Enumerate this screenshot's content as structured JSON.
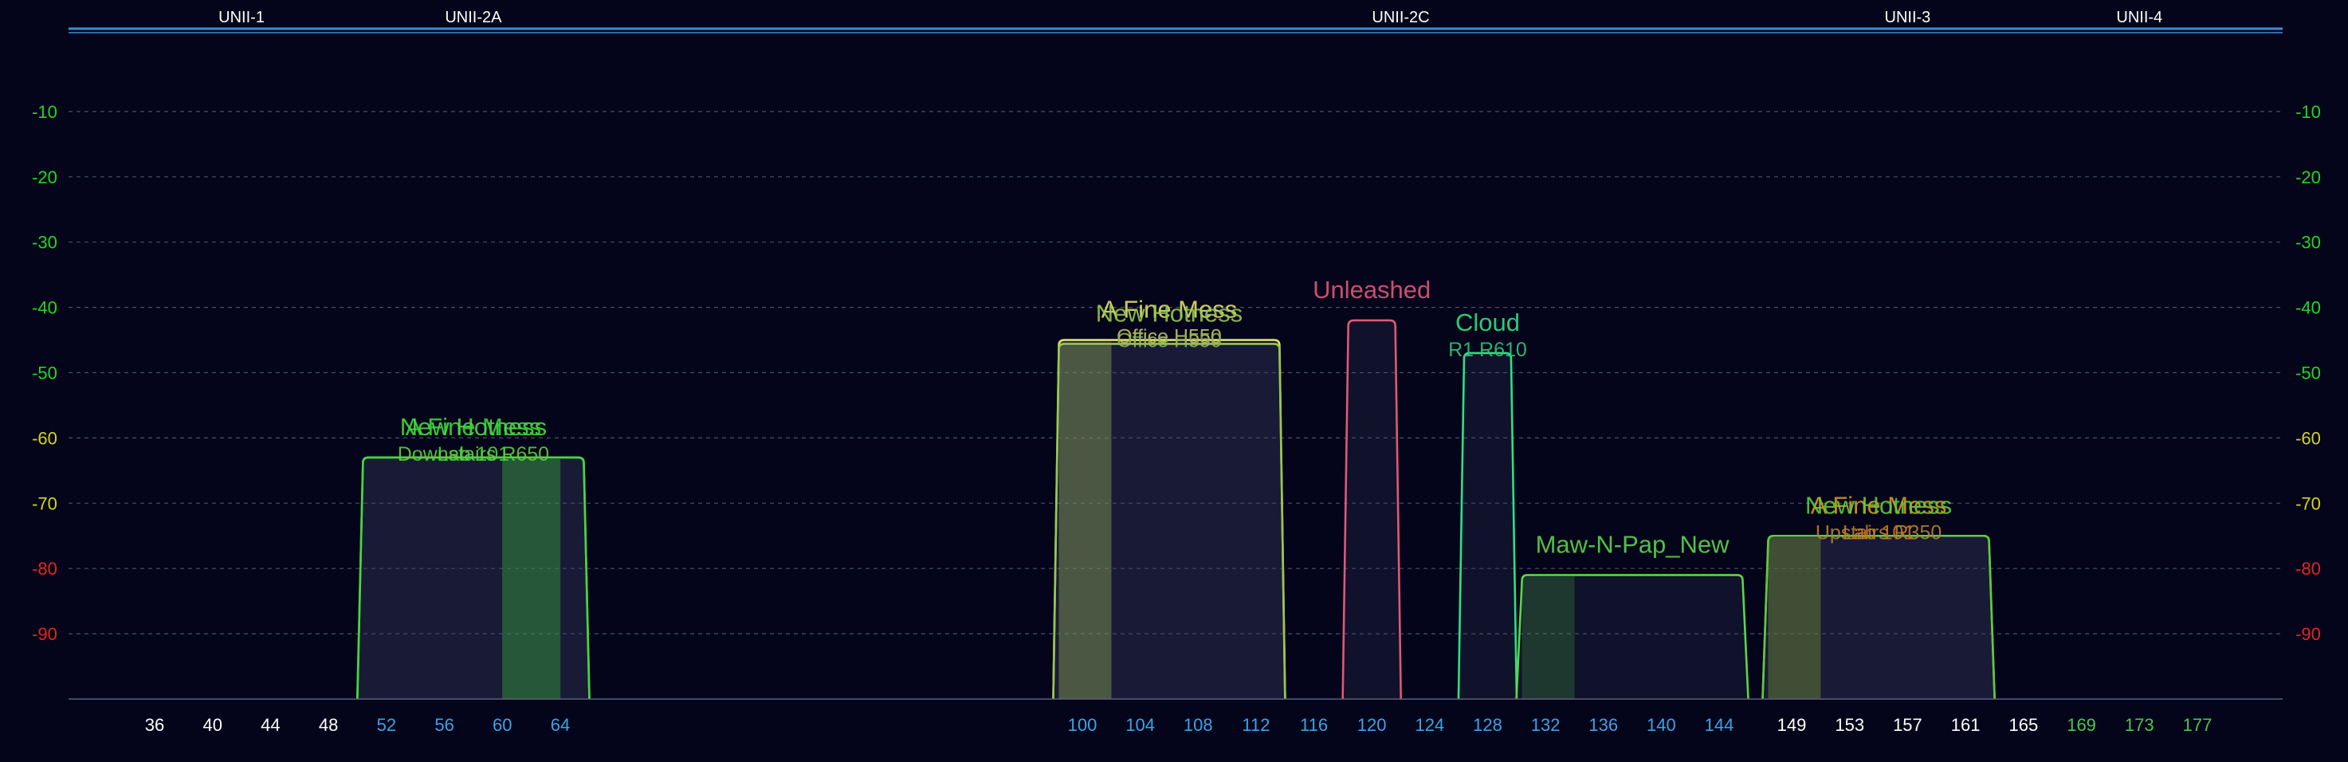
{
  "chart_data": {
    "type": "area",
    "title": "",
    "xlabel": "",
    "ylabel": "",
    "ylim": [
      -100,
      0
    ],
    "grid": true,
    "y_ticks": [
      {
        "value": -10,
        "color": "#22d722"
      },
      {
        "value": -20,
        "color": "#22d722"
      },
      {
        "value": -30,
        "color": "#22d722"
      },
      {
        "value": -40,
        "color": "#22d722"
      },
      {
        "value": -50,
        "color": "#22d722"
      },
      {
        "value": -60,
        "color": "#d4d41e"
      },
      {
        "value": -70,
        "color": "#d4d41e"
      },
      {
        "value": -80,
        "color": "#e0281e"
      },
      {
        "value": -90,
        "color": "#e0281e"
      }
    ],
    "x_ticks": [
      {
        "label": "36",
        "channel": 36,
        "color": "#ffffff"
      },
      {
        "label": "40",
        "channel": 40,
        "color": "#ffffff"
      },
      {
        "label": "44",
        "channel": 44,
        "color": "#ffffff"
      },
      {
        "label": "48",
        "channel": 48,
        "color": "#ffffff"
      },
      {
        "label": "52",
        "channel": 52,
        "color": "#3ba3e8"
      },
      {
        "label": "56",
        "channel": 56,
        "color": "#3ba3e8"
      },
      {
        "label": "60",
        "channel": 60,
        "color": "#3ba3e8"
      },
      {
        "label": "64",
        "channel": 64,
        "color": "#3ba3e8"
      },
      {
        "label": "100",
        "channel": 100,
        "color": "#3ba3e8"
      },
      {
        "label": "104",
        "channel": 104,
        "color": "#3ba3e8"
      },
      {
        "label": "108",
        "channel": 108,
        "color": "#3ba3e8"
      },
      {
        "label": "112",
        "channel": 112,
        "color": "#3ba3e8"
      },
      {
        "label": "116",
        "channel": 116,
        "color": "#3ba3e8"
      },
      {
        "label": "120",
        "channel": 120,
        "color": "#3ba3e8"
      },
      {
        "label": "124",
        "channel": 124,
        "color": "#3ba3e8"
      },
      {
        "label": "128",
        "channel": 128,
        "color": "#3ba3e8"
      },
      {
        "label": "132",
        "channel": 132,
        "color": "#3ba3e8"
      },
      {
        "label": "136",
        "channel": 136,
        "color": "#3ba3e8"
      },
      {
        "label": "140",
        "channel": 140,
        "color": "#3ba3e8"
      },
      {
        "label": "144",
        "channel": 144,
        "color": "#3ba3e8"
      },
      {
        "label": "149",
        "channel": 149,
        "color": "#ffffff"
      },
      {
        "label": "153",
        "channel": 153,
        "color": "#ffffff"
      },
      {
        "label": "157",
        "channel": 157,
        "color": "#ffffff"
      },
      {
        "label": "161",
        "channel": 161,
        "color": "#ffffff"
      },
      {
        "label": "165",
        "channel": 165,
        "color": "#ffffff"
      },
      {
        "label": "169",
        "channel": 169,
        "color": "#4cc64c"
      },
      {
        "label": "173",
        "channel": 173,
        "color": "#4cc64c"
      },
      {
        "label": "177",
        "channel": 177,
        "color": "#4cc64c"
      }
    ],
    "bands": [
      {
        "label": "UNII-1",
        "channel": 42
      },
      {
        "label": "UNII-2A",
        "channel": 58
      },
      {
        "label": "UNII-2C",
        "channel": 122
      },
      {
        "label": "UNII-3",
        "channel": 157
      },
      {
        "label": "UNII-4",
        "channel": 173
      }
    ],
    "series": [
      {
        "name": "A Fine Mess",
        "sub": "Lab 101",
        "ch_lo": 52,
        "ch_hi": 64,
        "primary": 62,
        "level": -63,
        "color": "#36d43a",
        "sub_color": "#3ed442"
      },
      {
        "name": "New Hotness",
        "sub": "Downstairs R650",
        "ch_lo": 52,
        "ch_hi": 64,
        "primary": 62,
        "level": -63,
        "color": "#4ad63e",
        "sub_color": "#62cc3c"
      },
      {
        "name": "A Fine Mess",
        "sub": "Office H550",
        "ch_lo": 100,
        "ch_hi": 112,
        "primary": 100,
        "level": -45,
        "color": "#e0e06a",
        "sub_color": "#c2c260"
      },
      {
        "name": "New Hotness",
        "sub": "Office H550",
        "ch_lo": 100,
        "ch_hi": 112,
        "primary": 100,
        "level": -45.6,
        "color": "#96c850",
        "sub_color": "#96b45a"
      },
      {
        "name": "Unleashed",
        "sub": "",
        "ch_lo": 120,
        "ch_hi": 120,
        "primary": null,
        "level": -42,
        "color": "#e05878",
        "sub_color": "#e05878"
      },
      {
        "name": "Cloud",
        "sub": "R1 R610",
        "ch_lo": 128,
        "ch_hi": 128,
        "primary": null,
        "level": -47,
        "color": "#2ee082",
        "sub_color": "#2ec878"
      },
      {
        "name": "Maw-N-Pap_New",
        "sub": "",
        "ch_lo": 132,
        "ch_hi": 144,
        "primary": 132,
        "level": -81,
        "color": "#5ad64a",
        "sub_color": "#5ad64a"
      },
      {
        "name": "A Fine Mess",
        "sub": "Lab 101",
        "ch_lo": 149,
        "ch_hi": 161,
        "primary": 149,
        "level": -75,
        "color": "#e09420",
        "sub_color": "#d4721e"
      },
      {
        "name": "New Hotness",
        "sub": "Upstairs R350",
        "ch_lo": 149,
        "ch_hi": 161,
        "primary": 149,
        "level": -75,
        "color": "#5ccc3c",
        "sub_color": "#b48232"
      }
    ]
  }
}
